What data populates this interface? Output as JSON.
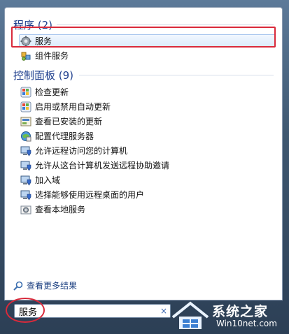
{
  "programs": {
    "header": "程序 (2)",
    "items": [
      {
        "label": "服务",
        "icon": "gear-icon"
      },
      {
        "label": "组件服务",
        "icon": "component-services-icon"
      }
    ]
  },
  "control_panel": {
    "header": "控制面板 (9)",
    "items": [
      {
        "label": "检查更新",
        "icon": "windows-update-icon"
      },
      {
        "label": "启用或禁用自动更新",
        "icon": "windows-update-icon"
      },
      {
        "label": "查看已安装的更新",
        "icon": "installed-updates-icon"
      },
      {
        "label": "配置代理服务器",
        "icon": "internet-options-icon"
      },
      {
        "label": "允许远程访问您的计算机",
        "icon": "system-shield-icon"
      },
      {
        "label": "允许从这台计算机发送远程协助邀请",
        "icon": "system-shield-icon"
      },
      {
        "label": "加入域",
        "icon": "system-shield-icon"
      },
      {
        "label": "选择能够使用远程桌面的用户",
        "icon": "system-shield-icon"
      },
      {
        "label": "查看本地服务",
        "icon": "admin-tools-icon"
      }
    ]
  },
  "see_more": "查看更多结果",
  "search": {
    "value": "服务",
    "clear": "×"
  },
  "watermark": {
    "brand": "系统之家",
    "sub": "Win10net.com"
  }
}
